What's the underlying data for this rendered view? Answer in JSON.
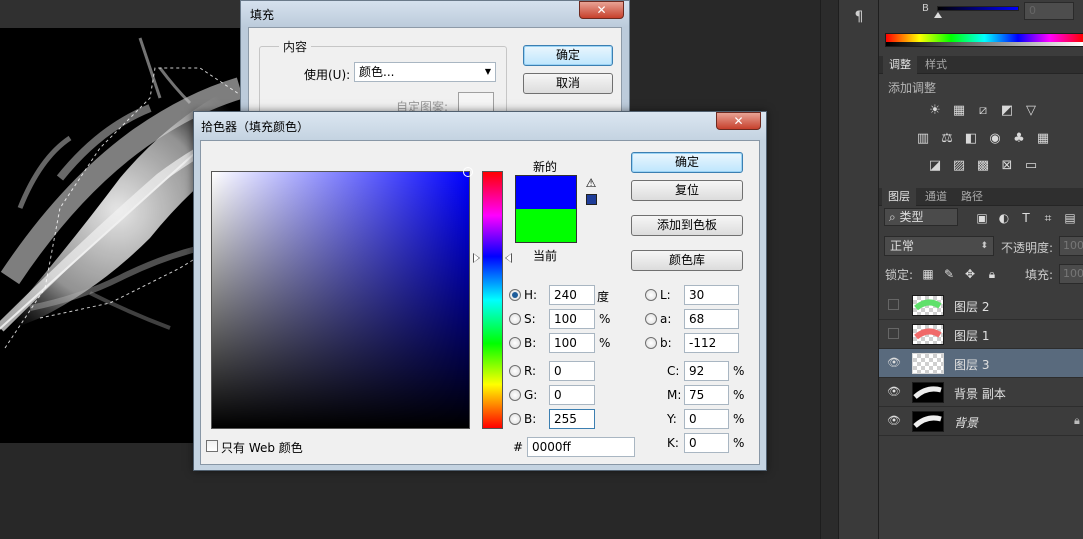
{
  "fill_dialog": {
    "title": "填充",
    "group_label": "内容",
    "use_label": "使用(U):",
    "use_value": "颜色...",
    "pattern_label": "自定图案:",
    "ok_label": "确定",
    "cancel_label": "取消",
    "close_symbol": "✕"
  },
  "picker": {
    "title": "拾色器（填充颜色）",
    "close_symbol": "✕",
    "new_label": "新的",
    "current_label": "当前",
    "new_color": "#0000ff",
    "current_color": "#00ff00",
    "warning_symbol": "⚠",
    "websafe_color": "#1f3d99",
    "buttons": {
      "ok": "确定",
      "reset": "复位",
      "add_to_swatches": "添加到色板",
      "color_libraries": "颜色库"
    },
    "hsb": {
      "h_label": "H:",
      "h_value": "240",
      "h_unit": "度",
      "s_label": "S:",
      "s_value": "100",
      "s_unit": "%",
      "b_label": "B:",
      "b_value": "100",
      "b_unit": "%"
    },
    "rgb": {
      "r_label": "R:",
      "r_value": "0",
      "g_label": "G:",
      "g_value": "0",
      "b_label": "B:",
      "b_value": "255"
    },
    "lab": {
      "l_label": "L:",
      "l_value": "30",
      "a_label": "a:",
      "a_value": "68",
      "b_label": "b:",
      "b_value": "-112"
    },
    "cmyk": {
      "c_label": "C:",
      "c_value": "92",
      "m_label": "M:",
      "m_value": "75",
      "y_label": "Y:",
      "y_value": "0",
      "k_label": "K:",
      "k_value": "0",
      "unit": "%"
    },
    "hex_label": "#",
    "hex_value": "0000ff",
    "web_only_label": "只有 Web 颜色"
  },
  "color_panel": {
    "slider_label": "B",
    "value": "0",
    "track_color": "#0000ff"
  },
  "adjustments": {
    "tabs": [
      "调整",
      "样式"
    ],
    "title": "添加调整",
    "icons": [
      [
        "brightness-icon",
        "levels-icon",
        "curves-icon",
        "exposure-icon",
        "vibrance-icon"
      ],
      [
        "hue-sat-icon",
        "color-balance-icon",
        "black-white-icon",
        "photo-filter-icon",
        "channel-mixer-icon",
        "color-lookup-icon"
      ],
      [
        "invert-icon",
        "posterize-icon",
        "threshold-icon",
        "selective-color-icon",
        "gradient-map-icon"
      ]
    ]
  },
  "layers": {
    "tabs": [
      "图层",
      "通道",
      "路径"
    ],
    "search_label": "类型",
    "blend_mode": "正常",
    "opacity_label": "不透明度:",
    "opacity_value": "100%",
    "lock_label": "锁定:",
    "fill_label": "填充:",
    "fill_value": "100%",
    "items": [
      {
        "name": "图层 2",
        "visible": false,
        "thumb": "green"
      },
      {
        "name": "图层 1",
        "visible": false,
        "thumb": "red"
      },
      {
        "name": "图层 3",
        "visible": true,
        "thumb": "empty",
        "selected": true
      },
      {
        "name": "背景 副本",
        "visible": true,
        "thumb": "feather"
      },
      {
        "name": "背景",
        "visible": true,
        "thumb": "feather",
        "italic": true,
        "locked": true
      }
    ]
  },
  "misc": {
    "paragraph_symbol": "¶"
  }
}
